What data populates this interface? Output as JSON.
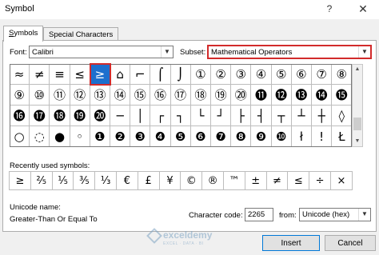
{
  "window": {
    "title": "Symbol",
    "help": "?",
    "close": "✕"
  },
  "tabs": [
    {
      "label": "Symbols",
      "underline": "S",
      "rest": "ymbols"
    },
    {
      "label": "Special Characters",
      "underline": "P",
      "rest": "Special Characters"
    }
  ],
  "font": {
    "label": "Font:",
    "value": "Calibri"
  },
  "subset": {
    "label": "Subset:",
    "value": "Mathematical Operators"
  },
  "grid": {
    "rows": [
      [
        "≈",
        "≠",
        "≡",
        "≤",
        "≥",
        "⌂",
        "⌐",
        "⌠",
        "⌡",
        "①",
        "②",
        "③",
        "④",
        "⑤",
        "⑥",
        "⑦",
        "⑧"
      ],
      [
        "⑨",
        "⑩",
        "⑪",
        "⑫",
        "⑬",
        "⑭",
        "⑮",
        "⑯",
        "⑰",
        "⑱",
        "⑲",
        "⑳",
        "⓫",
        "⓬",
        "⓭",
        "⓮",
        "⓯"
      ],
      [
        "⓰",
        "⓱",
        "⓲",
        "⓳",
        "⓴",
        "─",
        "│",
        "┌",
        "┐",
        "└",
        "┘",
        "├",
        "┤",
        "┬",
        "┴",
        "┼",
        "◊"
      ],
      [
        "○",
        "◌",
        "●",
        "◦",
        "❶",
        "❷",
        "❸",
        "❹",
        "❺",
        "❻",
        "❼",
        "❽",
        "❾",
        "❿",
        "ł",
        "ǃ",
        "Ł"
      ]
    ],
    "selected_symbol": "≥"
  },
  "recent": {
    "label": "Recently used symbols:",
    "symbols": [
      "≥",
      "⅖",
      "⅕",
      "⅗",
      "⅓",
      "€",
      "£",
      "¥",
      "©",
      "®",
      "™",
      "±",
      "≠",
      "≤",
      "÷",
      "×"
    ]
  },
  "unicode_name": {
    "label": "Unicode name:",
    "value": "Greater-Than Or Equal To"
  },
  "char_code": {
    "label": "Character code:",
    "value": "2265"
  },
  "from": {
    "label": "from:",
    "value": "Unicode (hex)"
  },
  "buttons": {
    "insert": "Insert",
    "cancel": "Cancel"
  },
  "watermark": {
    "brand": "exceldemy",
    "tag": "EXCEL · DATA · BI"
  }
}
